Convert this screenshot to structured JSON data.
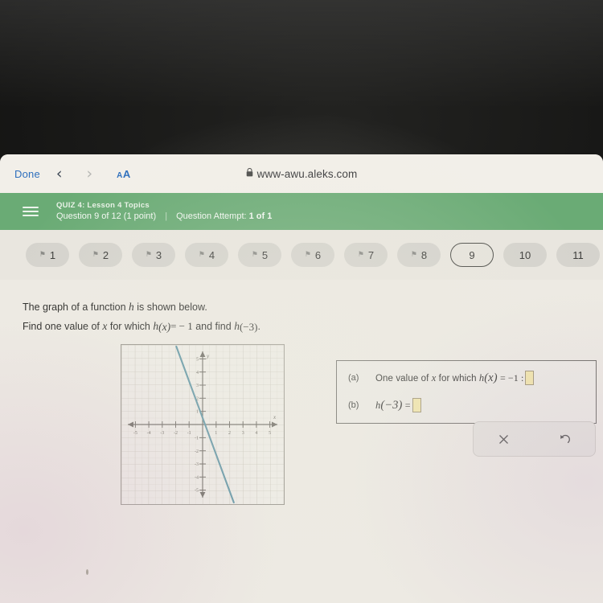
{
  "browser": {
    "done_label": "Done",
    "back_icon": "chevron-left-icon",
    "back_glyph": "‹",
    "forward_icon": "chevron-right-icon",
    "forward_glyph": "›",
    "text_size_label": "A",
    "text_size_label_small": "A",
    "lock_glyph": "🔒",
    "url": "www-awu.aleks.com"
  },
  "aleks_header": {
    "menu_icon": "hamburger-menu-icon",
    "quiz_title": "QUIZ 4: Lesson 4 Topics",
    "question_progress": "Question 9 of 12 (1 point)",
    "separator": "|",
    "attempt_prefix": "Question Attempt: ",
    "attempt_value": "1 of 1",
    "background_color": "#6aab75"
  },
  "tabs": [
    {
      "label": "1",
      "flag": "⚑",
      "current": false
    },
    {
      "label": "2",
      "flag": "⚑",
      "current": false
    },
    {
      "label": "3",
      "flag": "⚑",
      "current": false
    },
    {
      "label": "4",
      "flag": "⚑",
      "current": false
    },
    {
      "label": "5",
      "flag": "⚑",
      "current": false
    },
    {
      "label": "6",
      "flag": "⚑",
      "current": false
    },
    {
      "label": "7",
      "flag": "⚑",
      "current": false
    },
    {
      "label": "8",
      "flag": "⚑",
      "current": false
    },
    {
      "label": "9",
      "flag": "",
      "current": true
    },
    {
      "label": "10",
      "flag": "",
      "current": false
    },
    {
      "label": "11",
      "flag": "",
      "current": false
    }
  ],
  "question": {
    "line1_a": "The graph of a function ",
    "line1_h": "h",
    "line1_b": " is shown below.",
    "line2_a": "Find one value of ",
    "line2_x": "x",
    "line2_b": " for which ",
    "line2_h": "h",
    "line2_of_x": "(x)",
    "line2_eq": "= − 1",
    "line2_c": " and find ",
    "line2_h2": "h",
    "line2_of_neg3": "(−3)",
    "line2_end": "."
  },
  "answers": [
    {
      "label": "(a)",
      "text_before": "One value of ",
      "var": "x",
      "text_mid": " for which ",
      "fn": "h",
      "fn_arg": "(x)",
      "equals": "= −1 :",
      "input_value": "",
      "input_name": "answer-a-input"
    },
    {
      "label": "(b)",
      "text_before": "",
      "var": "",
      "text_mid": "",
      "fn": "h",
      "fn_arg": "(−3)",
      "equals": "=",
      "input_value": "",
      "input_name": "answer-b-input"
    }
  ],
  "tools": [
    {
      "name": "clear-button",
      "icon": "close-x-icon",
      "glyph": "✕"
    },
    {
      "name": "undo-button",
      "icon": "undo-arrow-icon",
      "glyph": "↺"
    }
  ],
  "colors": {
    "aleks_green": "#6aab75",
    "link_blue": "#2e6fbd",
    "graph_line": "#5e94a3",
    "input_yellow": "#f2e6a8",
    "page_bg": "#edeae3"
  },
  "chart_data": {
    "type": "line",
    "title": "",
    "xlabel": "x",
    "ylabel": "y",
    "xlim": [
      -5.8,
      5.8
    ],
    "ylim": [
      -5.8,
      5.8
    ],
    "xticks": [
      -5,
      -4,
      -3,
      -2,
      -1,
      1,
      2,
      3,
      4,
      5
    ],
    "yticks": [
      -5,
      -4,
      -3,
      -2,
      -1,
      1,
      2,
      3,
      4,
      5
    ],
    "grid": true,
    "series": [
      {
        "name": "h",
        "kind": "line",
        "slope": -2.5,
        "intercept": -0.8,
        "points": [
          {
            "x": -2.0,
            "y": 4.2
          },
          {
            "x": -1.0,
            "y": 1.7
          },
          {
            "x": -0.32,
            "y": 0.0
          },
          {
            "x": 0.0,
            "y": -0.8
          },
          {
            "x": 0.08,
            "y": -1.0
          },
          {
            "x": 1.0,
            "y": -3.3
          },
          {
            "x": 2.0,
            "y": -5.8
          }
        ],
        "color": "#5e94a3"
      }
    ],
    "annotations": [
      {
        "text": "x",
        "x": 5.5,
        "y": 0.45
      },
      {
        "text": "y",
        "x": 0.4,
        "y": 5.5
      }
    ]
  }
}
